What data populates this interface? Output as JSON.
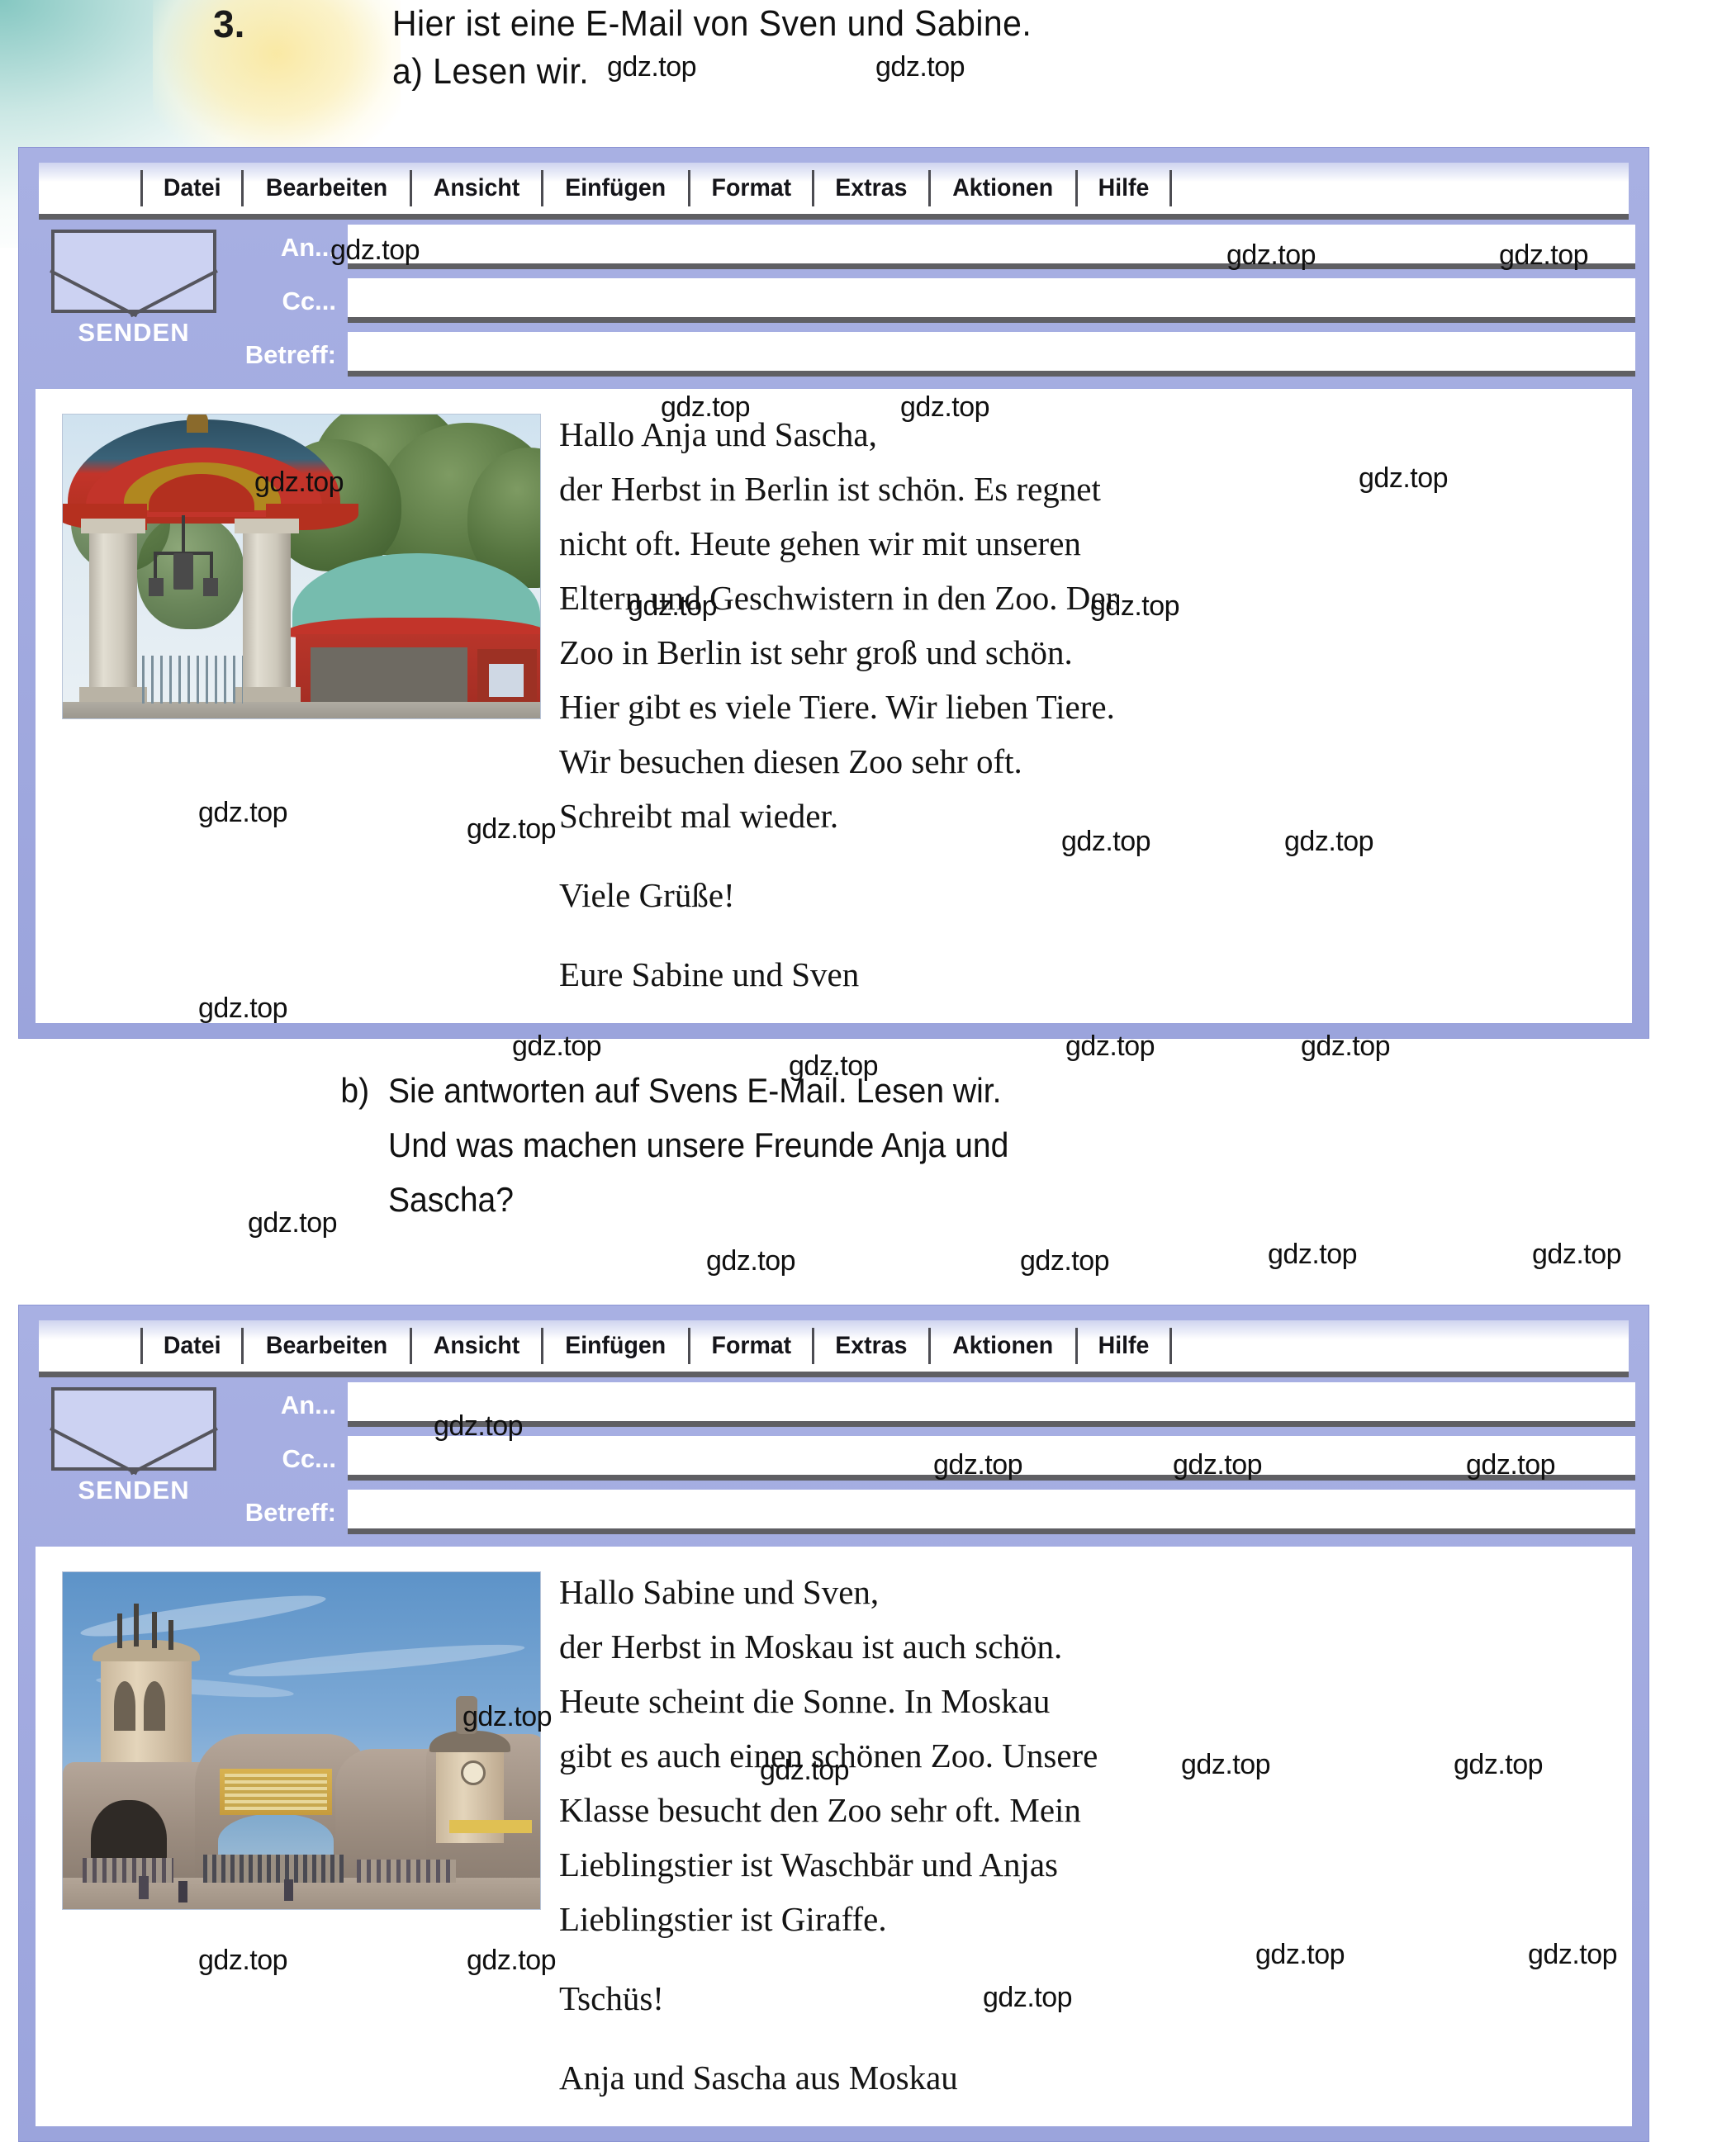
{
  "page": {
    "task_number": "3.",
    "headline_line_1": "Hier ist eine E-Mail von Sven und Sabine.",
    "headline_line_2": "a) Lesen wir.",
    "watermark_text": "gdz.top"
  },
  "prompt_b": {
    "label": "b)",
    "line_1": "Sie antworten auf Svens E-Mail. Lesen wir.",
    "line_2": "Und was machen unsere Freunde Anja und",
    "line_3": "Sascha?"
  },
  "mail_menu": {
    "items": [
      "Datei",
      "Bearbeiten",
      "Ansicht",
      "Einfügen",
      "Format",
      "Extras",
      "Aktionen",
      "Hilfe"
    ]
  },
  "mail_fields": {
    "send_label": "SENDEN",
    "to_label": "An...",
    "cc_label": "Cc...",
    "subject_label": "Betreff:",
    "to_value": "",
    "cc_value": "",
    "subject_value": ""
  },
  "email_1": {
    "photo_caption": "berlin-zoo-elephant-gate-photo",
    "greeting": "Hallo Anja und Sascha,",
    "body_line_1": "der Herbst in Berlin ist schön. Es regnet",
    "body_line_2": "nicht oft. Heute gehen wir mit unseren",
    "body_line_3": "Eltern und Geschwistern in den Zoo. Der",
    "body_line_4": "Zoo in Berlin ist sehr groß und schön.",
    "body_line_5": "Hier gibt es viele Tiere. Wir lieben Tiere.",
    "body_line_6": "Wir besuchen diesen Zoo sehr oft.",
    "body_line_7": "Schreibt mal wieder.",
    "closing": "Viele Grüße!",
    "signature": "Eure Sabine und Sven"
  },
  "email_2": {
    "photo_caption": "moscow-zoo-entrance-photo",
    "greeting": "Hallo Sabine und Sven,",
    "body_line_1": "der Herbst in Moskau ist auch schön.",
    "body_line_2": "Heute scheint die Sonne. In Moskau",
    "body_line_3": "gibt es auch einen schönen Zoo. Unsere",
    "body_line_4": "Klasse besucht den Zoo sehr oft. Mein",
    "body_line_5": "Lieblingstier ist  Waschbär und Anjas",
    "body_line_6": "Lieblingstier ist Giraffe.",
    "closing": "Tschüs!",
    "signature": "Anja und Sascha aus Moskau"
  },
  "colors": {
    "panel": "#a3abe0",
    "panel_border": "#8c95d4",
    "field_shadow": "#5f5f63",
    "text": "#111111",
    "label_text": "#ffffff"
  }
}
